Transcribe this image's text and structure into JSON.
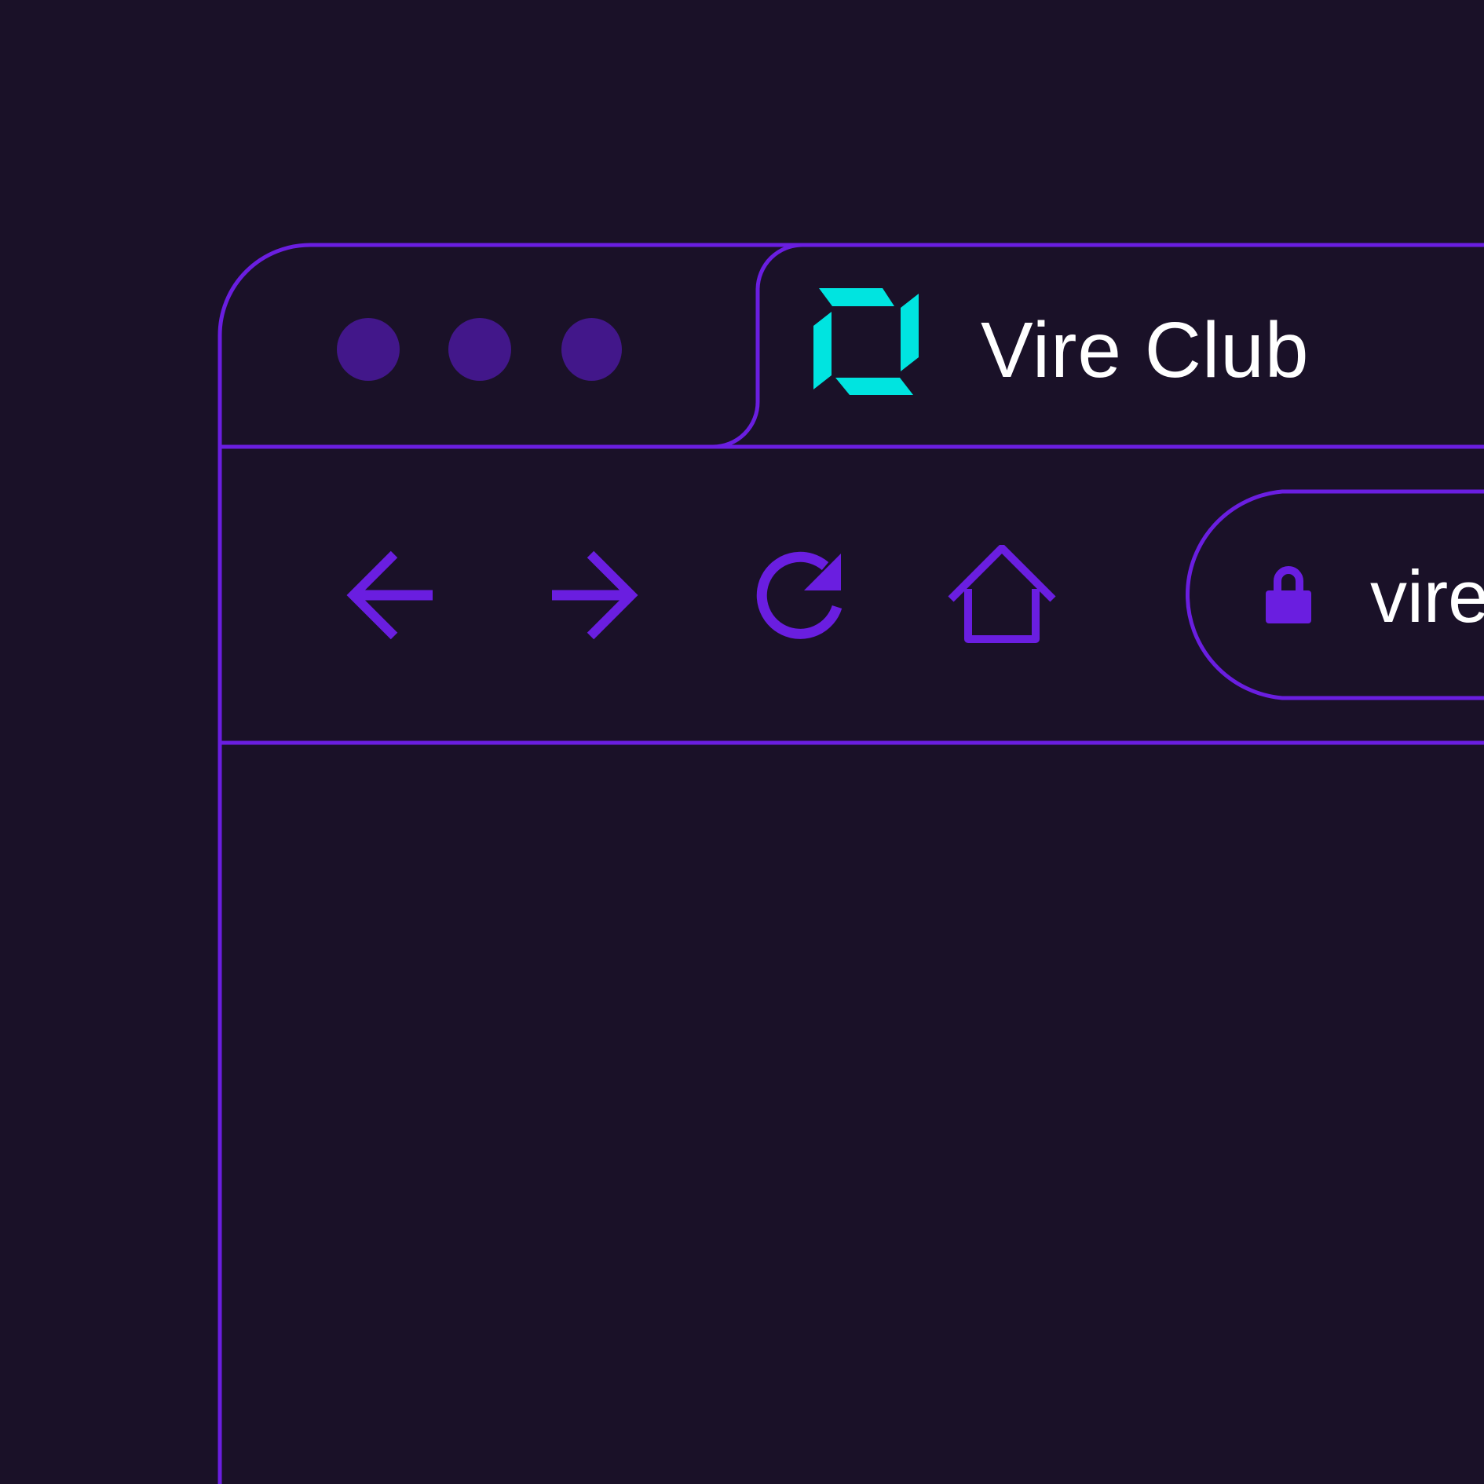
{
  "window": {
    "controls": [
      "close",
      "minimize",
      "maximize"
    ]
  },
  "tab": {
    "title": "Vire Club",
    "favicon": "vire-logo-icon"
  },
  "toolbar": {
    "buttons": [
      "back-arrow-icon",
      "forward-arrow-icon",
      "reload-icon",
      "home-icon"
    ]
  },
  "address_bar": {
    "url": "vire",
    "secure_icon": "lock-icon"
  },
  "colors": {
    "background": "#1a1128",
    "accent": "#6a1ee0",
    "window_control_dot": "#42178a",
    "logo": "#00e4e0",
    "text": "#ffffff"
  }
}
